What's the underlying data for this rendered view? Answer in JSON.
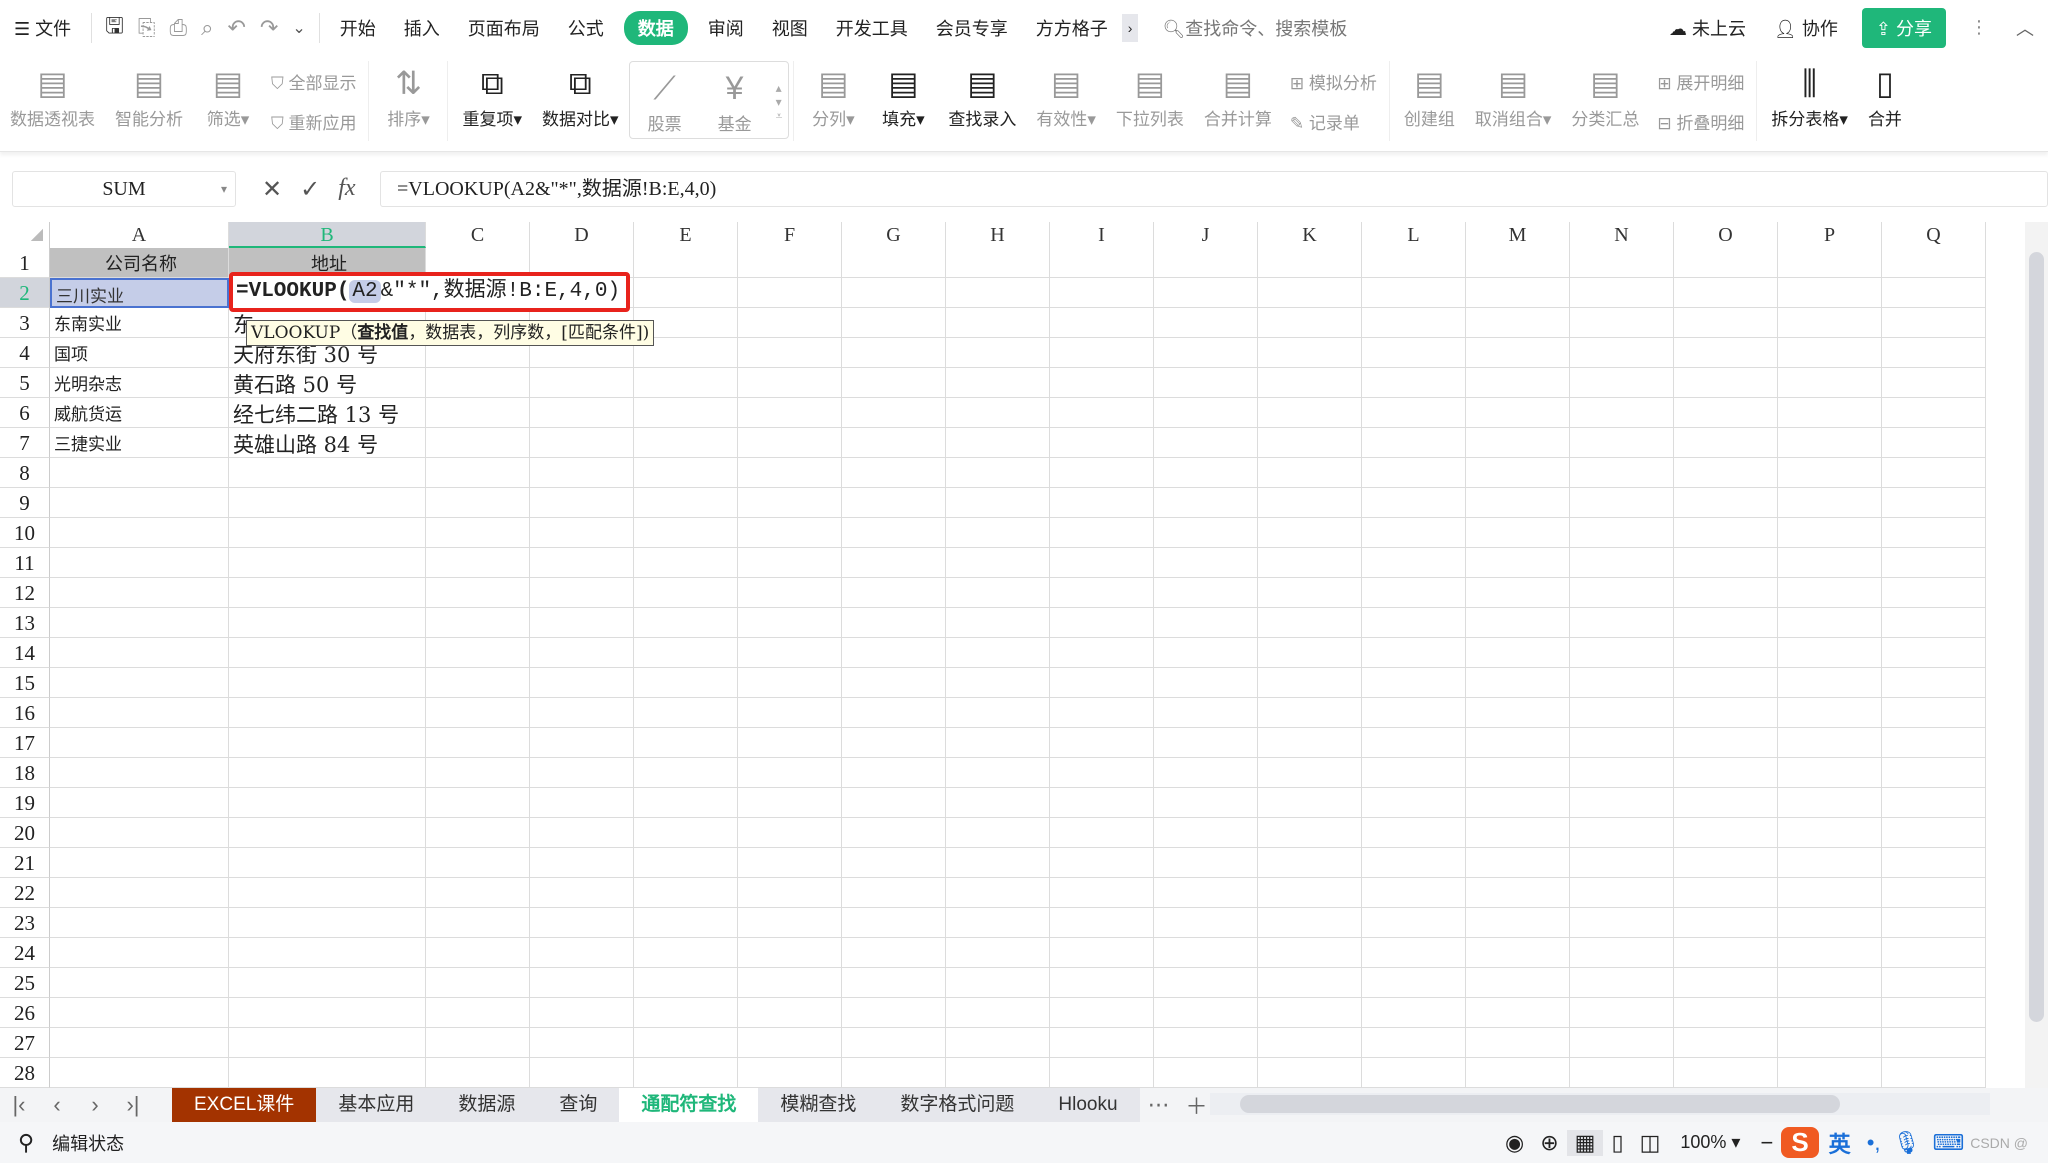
{
  "topbar": {
    "menu": "文件",
    "tabs": [
      "开始",
      "插入",
      "页面布局",
      "公式",
      "数据",
      "审阅",
      "视图",
      "开发工具",
      "会员专享",
      "方方格子"
    ],
    "active_tab": "数据",
    "search_placeholder": "查找命令、搜索模板",
    "cloud": "未上云",
    "collab": "协作",
    "share": "分享"
  },
  "ribbon": {
    "big1": [
      {
        "label": "数据透视表",
        "icon": "pivot-table-icon"
      },
      {
        "label": "智能分析",
        "icon": "smart-analysis-icon"
      },
      {
        "label": "筛选▾",
        "icon": "filter-icon"
      }
    ],
    "filter_small": [
      "全部显示",
      "重新应用"
    ],
    "sort": "排序▾",
    "dup": "重复项▾",
    "compare": "数据对比▾",
    "stock": "股票",
    "fund": "基金",
    "big2": [
      {
        "label": "分列▾",
        "icon": "split-column-icon",
        "on": false
      },
      {
        "label": "填充▾",
        "icon": "fill-icon",
        "on": true
      },
      {
        "label": "查找录入",
        "icon": "lookup-entry-icon",
        "on": true
      },
      {
        "label": "有效性▾",
        "icon": "validation-icon",
        "on": false
      },
      {
        "label": "下拉列表",
        "icon": "dropdown-list-icon",
        "on": false
      },
      {
        "label": "合并计算",
        "icon": "consolidate-icon",
        "on": false
      }
    ],
    "small2": [
      "模拟分析",
      "记录单"
    ],
    "big3": [
      {
        "label": "创建组",
        "icon": "group-icon"
      },
      {
        "label": "取消组合▾",
        "icon": "ungroup-icon"
      },
      {
        "label": "分类汇总",
        "icon": "subtotal-icon"
      }
    ],
    "small3": [
      "展开明细",
      "折叠明细"
    ],
    "split_table": "拆分表格▾",
    "merge": "合并"
  },
  "formula_bar": {
    "name_box": "SUM",
    "formula": "=VLOOKUP(A2&\"*\",数据源!B:E,4,0)"
  },
  "columns": [
    "A",
    "B",
    "C",
    "D",
    "E",
    "F",
    "G",
    "H",
    "I",
    "J",
    "K",
    "L",
    "M",
    "N",
    "O",
    "P",
    "Q"
  ],
  "selected_column": "B",
  "active_row": 2,
  "rows": [
    [
      "公司名称",
      "地址"
    ],
    [
      "三川实业",
      ""
    ],
    [
      "东南实业",
      "东"
    ],
    [
      "国项",
      "天府东街 30 号"
    ],
    [
      "光明杂志",
      "黄石路 50 号"
    ],
    [
      "威航货运",
      "经七纬二路 13 号"
    ],
    [
      "三捷实业",
      "英雄山路 84 号"
    ]
  ],
  "edit": {
    "func": "=VLOOKUP(",
    "ref": "A2",
    "rest": "&\"*\",数据源!B:E,4,0)"
  },
  "tooltip": {
    "func": "VLOOKUP（",
    "arg1": "查找值",
    "rest": "，数据表，列序数，[匹配条件])"
  },
  "sheet_tabs": [
    "EXCEL课件",
    "基本应用",
    "数据源",
    "查询",
    "通配符查找",
    "模糊查找",
    "数字格式问题",
    "Hlooku"
  ],
  "active_sheet": "通配符查找",
  "status": {
    "mode": "编辑状态",
    "zoom": "100%",
    "ime": "英",
    "watermark": "CSDN @"
  },
  "colors": {
    "accent": "#1fb77a",
    "highlight_border": "#e8231c",
    "brand_tab": "#a33300"
  }
}
